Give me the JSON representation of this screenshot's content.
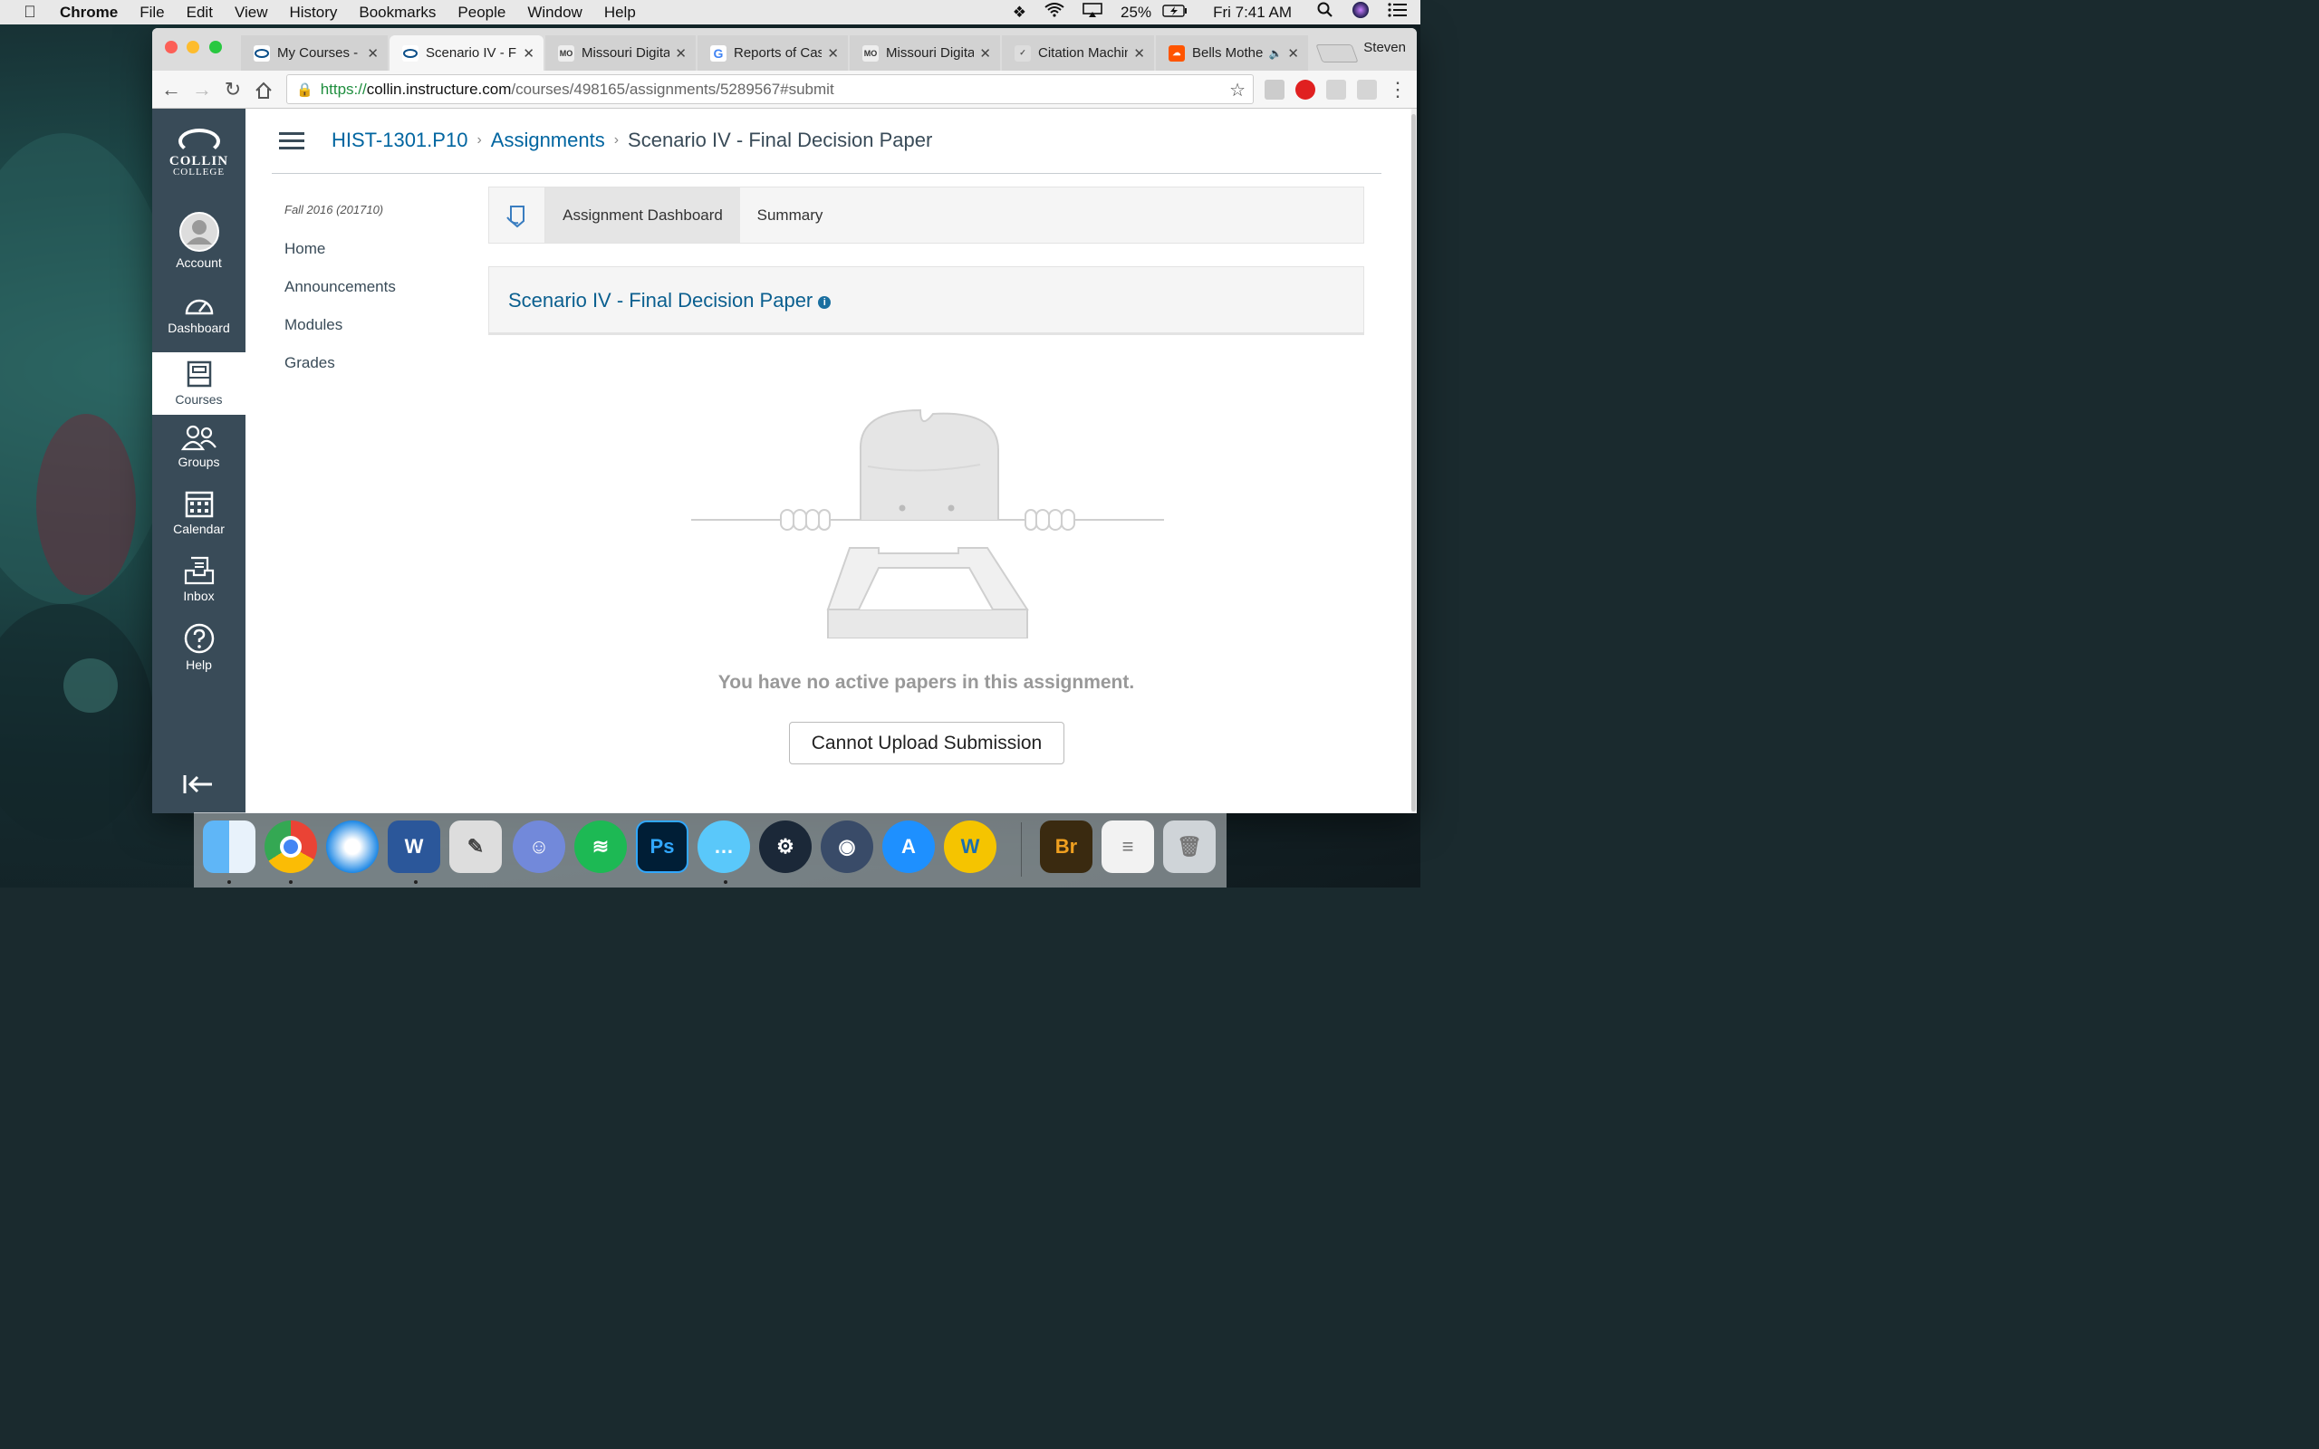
{
  "menubar": {
    "app": "Chrome",
    "items": [
      "File",
      "Edit",
      "View",
      "History",
      "Bookmarks",
      "People",
      "Window",
      "Help"
    ],
    "battery": "25%",
    "clock": "Fri 7:41 AM"
  },
  "browser": {
    "profile": "Steven",
    "tabs": [
      {
        "title": "My Courses - C",
        "favicon": "collin-icon"
      },
      {
        "title": "Scenario IV - F",
        "favicon": "collin-icon"
      },
      {
        "title": "Missouri Digita",
        "favicon": "mosos-icon"
      },
      {
        "title": "Reports of Cas",
        "favicon": "google-icon"
      },
      {
        "title": "Missouri Digita",
        "favicon": "mosos-icon"
      },
      {
        "title": "Citation Machin",
        "favicon": "citation-machine-icon"
      },
      {
        "title": "Bells Mothe",
        "favicon": "soundcloud-icon"
      }
    ],
    "url": {
      "scheme": "https://",
      "host": "collin.instructure.com",
      "path": "/courses/498165/assignments/5289567#submit"
    }
  },
  "globalnav": {
    "logo_line1": "COLLIN",
    "logo_line2": "COLLEGE",
    "items": [
      {
        "label": "Account",
        "icon": "account-icon"
      },
      {
        "label": "Dashboard",
        "icon": "dashboard-icon"
      },
      {
        "label": "Courses",
        "icon": "courses-icon"
      },
      {
        "label": "Groups",
        "icon": "groups-icon"
      },
      {
        "label": "Calendar",
        "icon": "calendar-icon"
      },
      {
        "label": "Inbox",
        "icon": "inbox-icon"
      },
      {
        "label": "Help",
        "icon": "help-icon"
      }
    ]
  },
  "breadcrumb": {
    "course": "HIST-1301.P10",
    "section": "Assignments",
    "current": "Scenario IV - Final Decision Paper"
  },
  "coursenav": {
    "term": "Fall 2016 (201710)",
    "items": [
      "Home",
      "Announcements",
      "Modules",
      "Grades"
    ]
  },
  "turnitin": {
    "tab_dashboard": "Assignment Dashboard",
    "tab_summary": "Summary",
    "assignment_title": "Scenario IV - Final Decision Paper",
    "empty_message": "You have no active papers in this assignment.",
    "upload_button": "Cannot Upload Submission"
  },
  "dock": {
    "apps": [
      "Finder",
      "Chrome",
      "Safari",
      "Word",
      "Script Editor",
      "Discord",
      "Spotify",
      "Photoshop",
      "Messages",
      "Steam",
      "TeamSpeak",
      "App Store",
      "Bridge Trophy",
      "Bridge",
      "Documents",
      "Trash"
    ]
  }
}
